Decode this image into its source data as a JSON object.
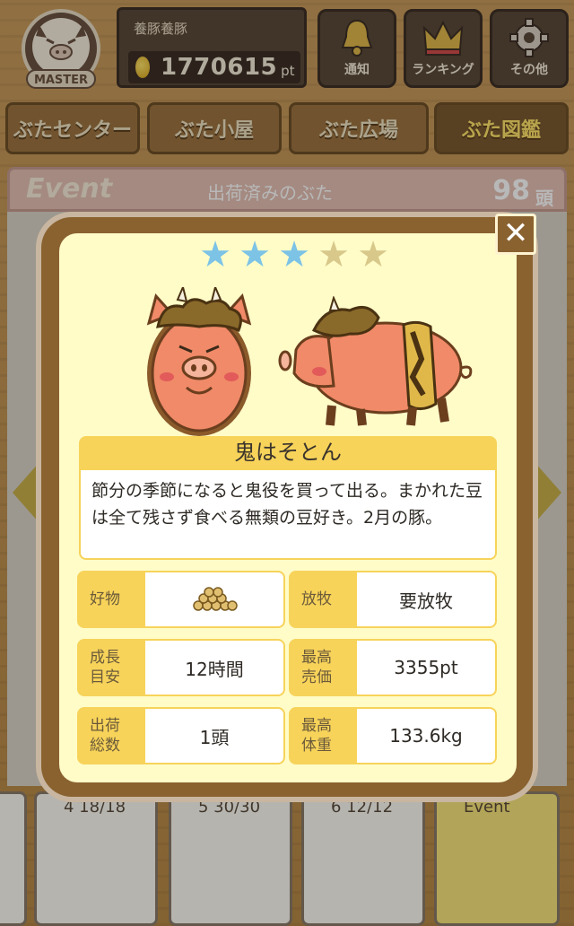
{
  "header": {
    "badge_text": "MASTER",
    "user_name": "養豚養豚",
    "points": "1770615",
    "points_unit": "pt",
    "buttons": [
      {
        "label": "通知",
        "icon": "bell-icon"
      },
      {
        "label": "ランキング",
        "icon": "crown-icon"
      },
      {
        "label": "その他",
        "icon": "gear-icon"
      }
    ]
  },
  "nav": {
    "tabs": [
      "ぶたセンター",
      "ぶた小屋",
      "ぶた広場",
      "ぶた図鑑"
    ],
    "active_tab": "ぶた図鑑"
  },
  "event_strip": {
    "label": "Event",
    "title": "出荷済みのぶた",
    "count": "98",
    "unit": "頭"
  },
  "bottom_cards": [
    {
      "tag": "4 18/18"
    },
    {
      "tag": "5 30/30"
    },
    {
      "tag": "6 12/12"
    },
    {
      "tag": "Event"
    }
  ],
  "modal": {
    "close_label": "✕",
    "rating": {
      "filled": 3,
      "total": 5
    },
    "colors": {
      "star_filled": "#7cc3e6",
      "star_empty": "#d8c88a",
      "accent": "#f7d35a"
    },
    "pig_name": "鬼はそとん",
    "description": "節分の季節になると鬼役を買って出る。まかれた豆は全て残さず食べる無類の豆好き。2月の豚。",
    "stats": {
      "favorite": {
        "label": "好物",
        "icon": "soybeans-icon"
      },
      "grazing": {
        "label": "放牧",
        "value": "要放牧"
      },
      "growth": {
        "label": "成長\n目安",
        "value": "12時間"
      },
      "max_price": {
        "label": "最高\n売価",
        "value": "3355pt"
      },
      "shipped": {
        "label": "出荷\n総数",
        "value": "1頭"
      },
      "max_weight": {
        "label": "最高\n体重",
        "value": "133.6kg"
      }
    }
  }
}
